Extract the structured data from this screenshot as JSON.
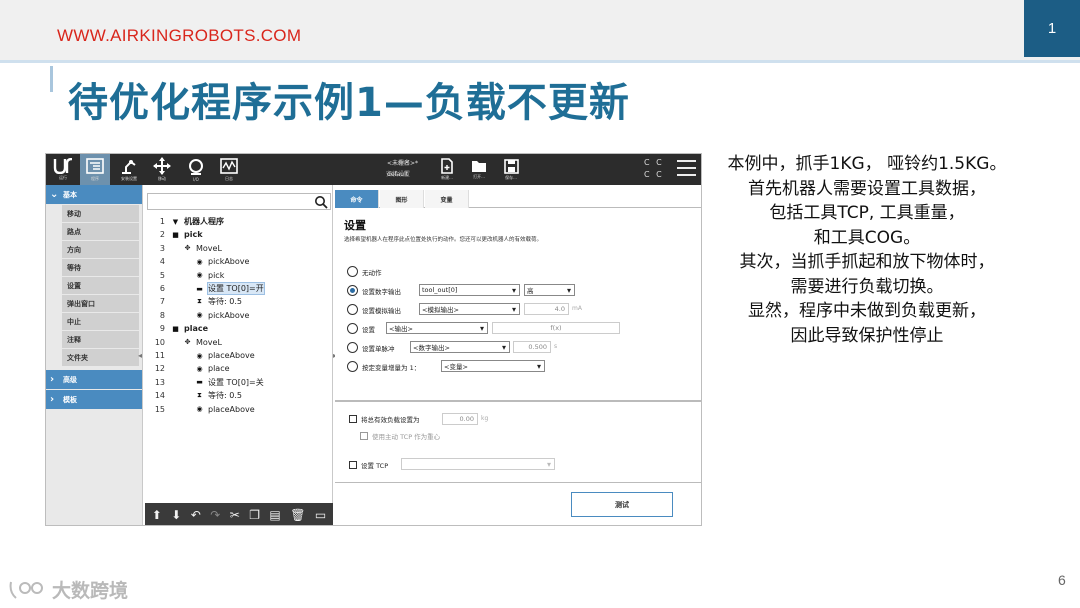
{
  "slide": {
    "website": "WWW.AIRKINGROBOTS.COM",
    "header_number": "1",
    "title": "待优化程序示例1—负载不更新",
    "page_number": "6",
    "watermark": "大数跨境",
    "description": [
      "本例中，抓手1KG， 哑铃约1.5KG。",
      "首先机器人需要设置工具数据，",
      "包括工具TCP, 工具重量，",
      "和工具COG。",
      "其次，当抓手抓起和放下物体时，",
      "需要进行负载切换。",
      "显然，程序中未做到负载更新，",
      "因此导致保护性停止"
    ]
  },
  "robot_ui": {
    "topbar": {
      "buttons": [
        {
          "label": "运行",
          "icon": "ur-logo-icon"
        },
        {
          "label": "程序",
          "icon": "program-icon"
        },
        {
          "label": "安装设置",
          "icon": "installation-icon"
        },
        {
          "label": "移动",
          "icon": "move-icon"
        },
        {
          "label": "I/O",
          "icon": "io-icon"
        },
        {
          "label": "日志",
          "icon": "log-icon"
        }
      ],
      "file_labels": [
        "程序",
        "安装设置"
      ],
      "file_values": [
        "<未命名>*",
        "default"
      ],
      "file_actions": [
        "新建...",
        "打开...",
        "保存..."
      ],
      "cc_text": "C C"
    },
    "left_panel": {
      "basic_section": "基本",
      "basic_items": [
        "移动",
        "路点",
        "方向",
        "等待",
        "设置",
        "弹出窗口",
        "中止",
        "注释",
        "文件夹"
      ],
      "advanced_section": "高级",
      "template_section": "模板"
    },
    "tree": {
      "lines": [
        {
          "num": "1",
          "text": "机器人程序",
          "icon": "▼",
          "bold": true
        },
        {
          "num": "2",
          "text": "pick",
          "icon": "■",
          "bold": true
        },
        {
          "num": "3",
          "text": "MoveL",
          "icon": "✥",
          "bold": false
        },
        {
          "num": "4",
          "text": "pickAbove",
          "icon": "◉",
          "bold": false
        },
        {
          "num": "5",
          "text": "pick",
          "icon": "◉",
          "bold": false
        },
        {
          "num": "6",
          "text": "设置 TO[0]=开",
          "icon": "▬",
          "bold": false,
          "highlight": true
        },
        {
          "num": "7",
          "text": "等待: 0.5",
          "icon": "⧗",
          "bold": false
        },
        {
          "num": "8",
          "text": "pickAbove",
          "icon": "◉",
          "bold": false
        },
        {
          "num": "9",
          "text": "place",
          "icon": "■",
          "bold": true
        },
        {
          "num": "10",
          "text": "MoveL",
          "icon": "✥",
          "bold": false
        },
        {
          "num": "11",
          "text": "placeAbove",
          "icon": "◉",
          "bold": false
        },
        {
          "num": "12",
          "text": "place",
          "icon": "◉",
          "bold": false
        },
        {
          "num": "13",
          "text": "设置 TO[0]=关",
          "icon": "▬",
          "bold": false
        },
        {
          "num": "14",
          "text": "等待: 0.5",
          "icon": "⧗",
          "bold": false
        },
        {
          "num": "15",
          "text": "placeAbove",
          "icon": "◉",
          "bold": false
        }
      ]
    },
    "right_panel": {
      "tabs": [
        "命令",
        "图形",
        "变量"
      ],
      "title": "设置",
      "subtitle": "选择希望机器人在程序此点位置处执行的动作。您还可以更改机器人的有效载荷。",
      "options": {
        "no_action": "无动作",
        "digital_output": "设置数字输出",
        "analog_output": "设置模拟输出",
        "set": "设置",
        "single_pulse": "设置单脉冲",
        "increment_var": "按定变量增量为 1："
      },
      "digital_output_value": "tool_out[0]",
      "digital_level_value": "高",
      "analog_output_value": "<模拟输出>",
      "analog_value": "4.0",
      "analog_unit": "mA",
      "set_output_value": "<输出>",
      "set_expr_value": "f(x)",
      "pulse_output_value": "<数字输出>",
      "pulse_value": "0.500",
      "pulse_unit": "s",
      "variable_value": "<变量>",
      "payload_label": "将总有效负载设置为",
      "payload_value": "0.00",
      "payload_unit": "kg",
      "use_tcp_label": "使用主动 TCP 作为重心",
      "set_tcp_label": "设置 TCP",
      "test_button": "测试"
    }
  }
}
